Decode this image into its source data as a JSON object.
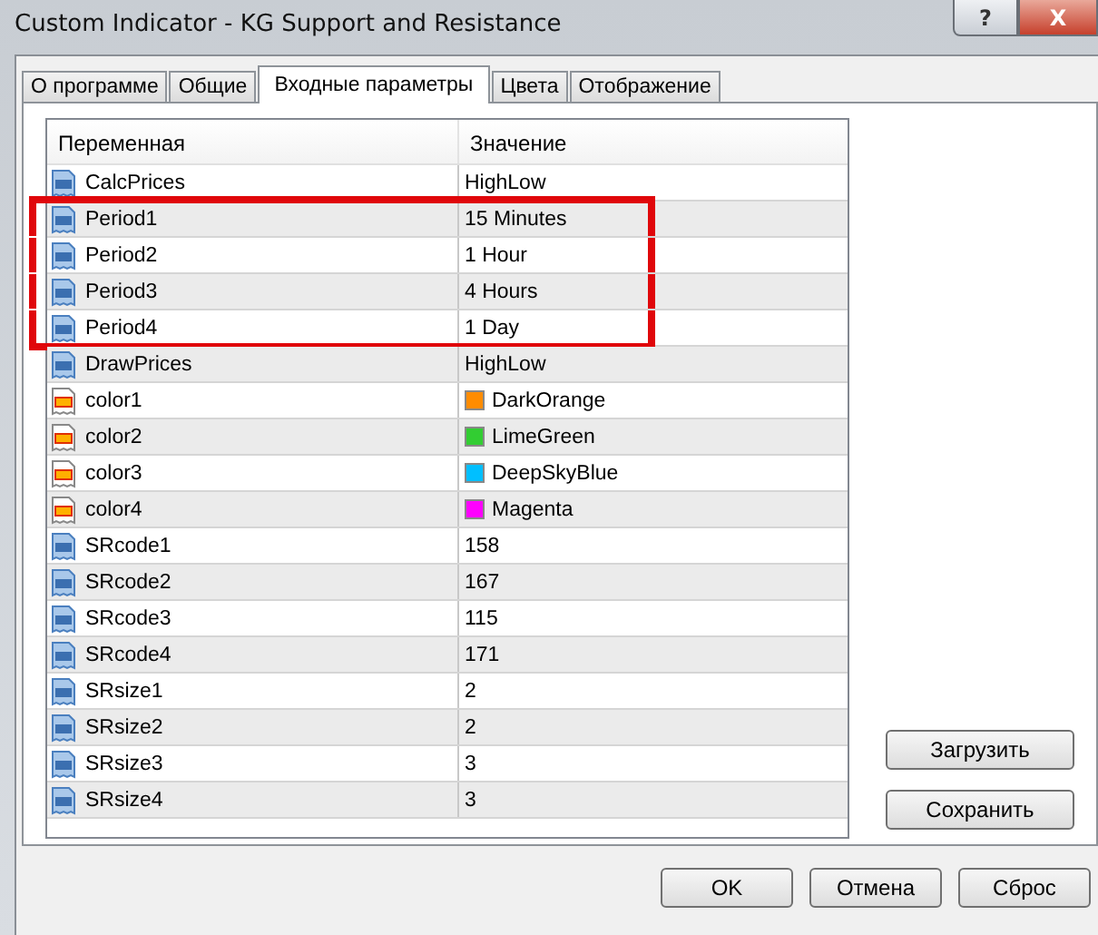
{
  "window": {
    "title": "Custom Indicator - KG Support and Resistance",
    "buttons": [
      "?",
      "X"
    ]
  },
  "tabs": [
    {
      "label": "О программе",
      "selected": false
    },
    {
      "label": "Общие",
      "selected": false
    },
    {
      "label": "Входные параметры",
      "selected": true
    },
    {
      "label": "Цвета",
      "selected": false
    },
    {
      "label": "Отображение",
      "selected": false
    }
  ],
  "table": {
    "columns": [
      "Переменная",
      "Значение"
    ],
    "rows": [
      {
        "kind": "number",
        "name": "CalcPrices",
        "value": "HighLow",
        "highlighted": false
      },
      {
        "kind": "number",
        "name": "Period1",
        "value": "15 Minutes",
        "highlighted": true
      },
      {
        "kind": "number",
        "name": "Period2",
        "value": "1 Hour",
        "highlighted": true
      },
      {
        "kind": "number",
        "name": "Period3",
        "value": "4 Hours",
        "highlighted": true
      },
      {
        "kind": "number",
        "name": "Period4",
        "value": "1 Day",
        "highlighted": true
      },
      {
        "kind": "number",
        "name": "DrawPrices",
        "value": "HighLow",
        "highlighted": false
      },
      {
        "kind": "color",
        "name": "color1",
        "value": "DarkOrange",
        "color": "#ff8c00",
        "highlighted": false
      },
      {
        "kind": "color",
        "name": "color2",
        "value": "LimeGreen",
        "color": "#32cd32",
        "highlighted": false
      },
      {
        "kind": "color",
        "name": "color3",
        "value": "DeepSkyBlue",
        "color": "#00bfff",
        "highlighted": false
      },
      {
        "kind": "color",
        "name": "color4",
        "value": "Magenta",
        "color": "#ff00ff",
        "highlighted": false
      },
      {
        "kind": "number",
        "name": "SRcode1",
        "value": "158",
        "highlighted": false
      },
      {
        "kind": "number",
        "name": "SRcode2",
        "value": "167",
        "highlighted": false
      },
      {
        "kind": "number",
        "name": "SRcode3",
        "value": "115",
        "highlighted": false
      },
      {
        "kind": "number",
        "name": "SRcode4",
        "value": "171",
        "highlighted": false
      },
      {
        "kind": "number",
        "name": "SRsize1",
        "value": "2",
        "highlighted": false
      },
      {
        "kind": "number",
        "name": "SRsize2",
        "value": "2",
        "highlighted": false
      },
      {
        "kind": "number",
        "name": "SRsize3",
        "value": "3",
        "highlighted": false
      },
      {
        "kind": "number",
        "name": "SRsize4",
        "value": "3",
        "highlighted": false
      }
    ]
  },
  "side_buttons": [
    "Загрузить",
    "Сохранить"
  ],
  "footer_buttons": [
    "OK",
    "Отмена",
    "Сброс"
  ]
}
